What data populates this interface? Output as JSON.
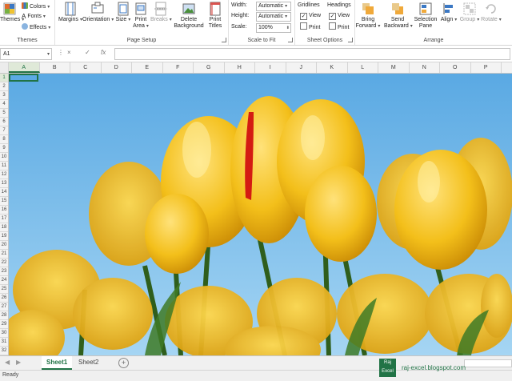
{
  "ribbon": {
    "themes": {
      "button": "Themes",
      "colors": "Colors",
      "fonts": "Fonts",
      "effects": "Effects",
      "group": "Themes"
    },
    "page_setup": {
      "margins": "Margins",
      "orientation": "Orientation",
      "size": "Size",
      "print_area_1": "Print",
      "print_area_2": "Area",
      "breaks": "Breaks",
      "background_1": "Delete",
      "background_2": "Background",
      "print_titles_1": "Print",
      "print_titles_2": "Titles",
      "group": "Page Setup"
    },
    "scale_to_fit": {
      "width_label": "Width:",
      "width_value": "Automatic",
      "height_label": "Height:",
      "height_value": "Automatic",
      "scale_label": "Scale:",
      "scale_value": "100%",
      "group": "Scale to Fit"
    },
    "sheet_options": {
      "gridlines": "Gridlines",
      "headings": "Headings",
      "view": "View",
      "print": "Print",
      "group": "Sheet Options"
    },
    "arrange": {
      "bring_forward_1": "Bring",
      "bring_forward_2": "Forward",
      "send_backward_1": "Send",
      "send_backward_2": "Backward",
      "selection_pane_1": "Selection",
      "selection_pane_2": "Pane",
      "align": "Align",
      "group_btn": "Group",
      "rotate": "Rotate",
      "group": "Arrange"
    }
  },
  "formula_bar": {
    "name_box": "A1",
    "cancel_icon": "×",
    "enter_icon": "✓",
    "fx": "fx"
  },
  "columns": [
    "A",
    "B",
    "C",
    "D",
    "E",
    "F",
    "G",
    "H",
    "I",
    "J",
    "K",
    "L",
    "M",
    "N",
    "O",
    "P",
    "Q"
  ],
  "rows": [
    "1",
    "2",
    "3",
    "4",
    "5",
    "6",
    "7",
    "8",
    "9",
    "10",
    "11",
    "12",
    "13",
    "14",
    "15",
    "16",
    "17",
    "18",
    "19",
    "20",
    "21",
    "22",
    "23",
    "24",
    "25",
    "26",
    "27",
    "28",
    "29",
    "30",
    "31",
    "32"
  ],
  "sheets": [
    {
      "name": "Sheet1",
      "active": true
    },
    {
      "name": "Sheet2",
      "active": false
    }
  ],
  "status": {
    "ready": "Ready"
  },
  "watermark": {
    "logo_line1": "Raj",
    "logo_line2": "Excel",
    "text": "raj-excel.blogspot.com"
  },
  "colors": {
    "accent": "#217346",
    "sky": "#7fc2ec",
    "petal": "#f3bf1a",
    "stem": "#2f5e1c"
  }
}
